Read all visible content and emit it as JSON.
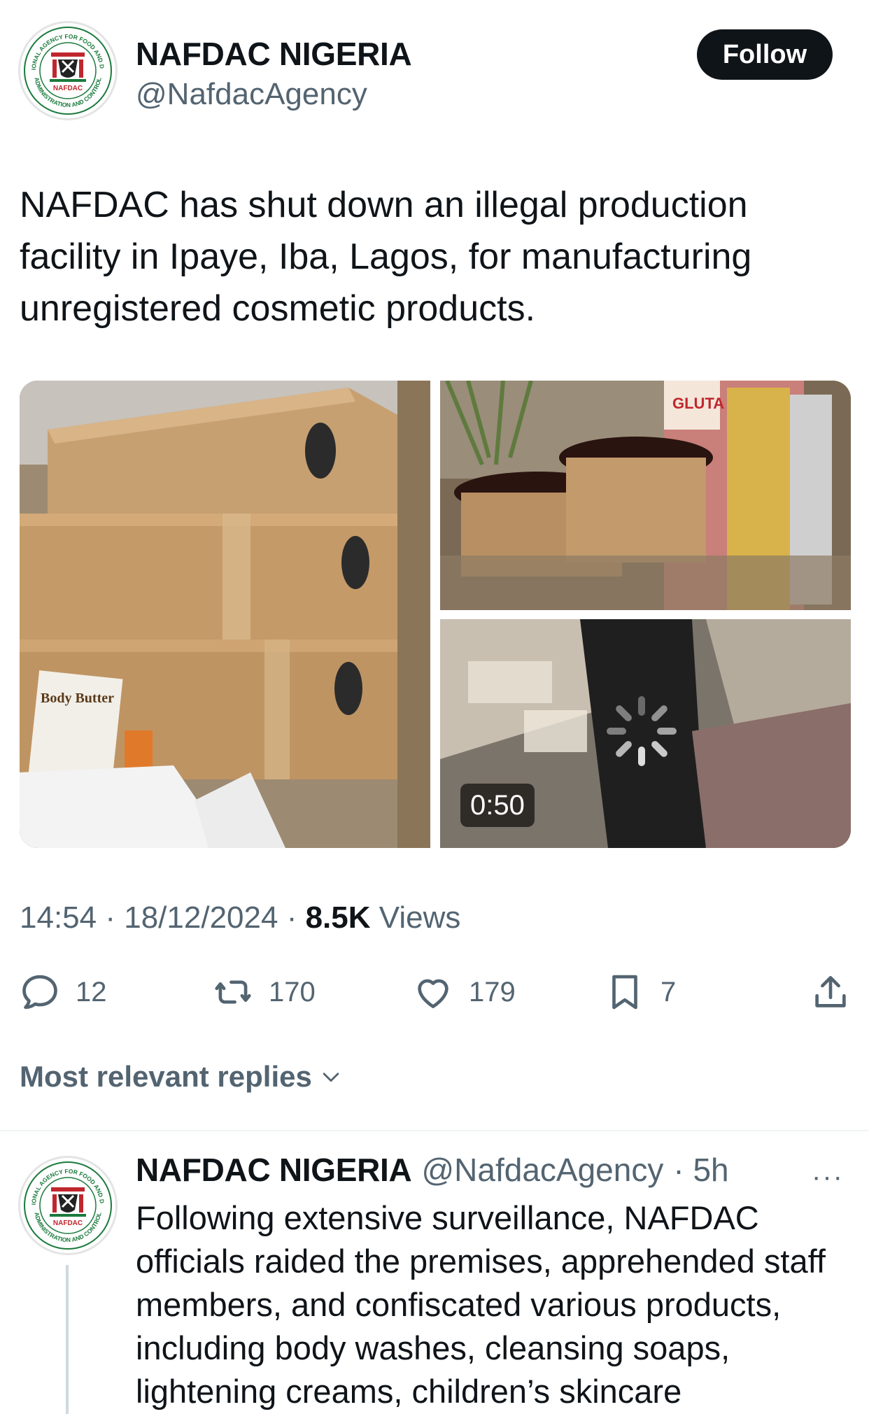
{
  "tweet": {
    "author_name": "NAFDAC NIGERIA",
    "author_handle": "@NafdacAgency",
    "follow_label": "Follow",
    "text": "NAFDAC has shut down an illegal production facility in Ipaye, Iba, Lagos, for manufacturing unregistered cosmetic products.",
    "media": {
      "video_duration": "0:50",
      "box_label": "Body Butter",
      "sign_label": "GLUTA"
    },
    "time": "14:54",
    "date": "18/12/2024",
    "views_count": "8.5K",
    "views_label": "Views",
    "separator": "·"
  },
  "logo": {
    "ring_top": "NATIONAL AGENCY FOR FOOD AND DRUG",
    "ring_bottom": "ADMINISTRATION AND CONTROL",
    "center": "NAFDAC"
  },
  "actions": {
    "replies": "12",
    "reposts": "170",
    "likes": "179",
    "bookmarks": "7"
  },
  "replies_sort": {
    "label": "Most relevant replies"
  },
  "reply": {
    "author_name": "NAFDAC NIGERIA",
    "author_handle": "@NafdacAgency",
    "time_ago": "· 5h",
    "more": "···",
    "text": "Following extensive surveillance, NAFDAC officials raided the premises, apprehended staff members, and confiscated various products, including body washes, cleansing soaps, lightening creams, children’s skincare"
  },
  "colors": {
    "text": "#0f1419",
    "secondary": "#536471",
    "button_bg": "#0f1419",
    "logo_green": "#1b7a3c",
    "logo_red": "#c0272d"
  }
}
